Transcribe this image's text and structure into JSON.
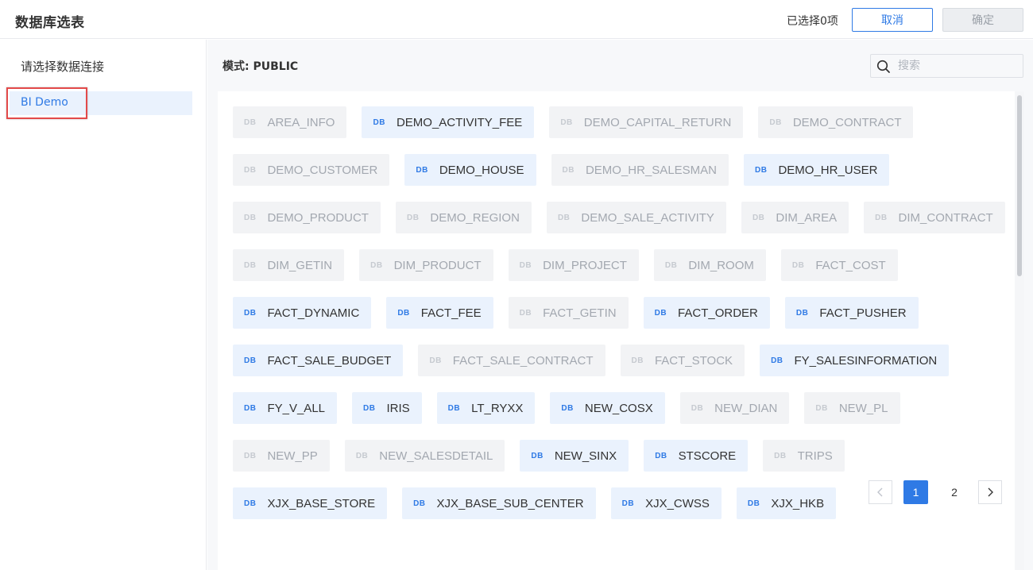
{
  "header": {
    "title": "数据库选表",
    "selected_count": "已选择0项",
    "cancel_label": "取消",
    "confirm_label": "确定"
  },
  "sidebar": {
    "section_label": "请选择数据连接",
    "connections": [
      {
        "label": "BI Demo",
        "selected": true
      }
    ]
  },
  "main": {
    "schema_label": "模式: PUBLIC",
    "search": {
      "placeholder": "搜索",
      "value": ""
    },
    "db_badge": "DB",
    "tables": [
      {
        "name": "AREA_INFO",
        "enabled": false
      },
      {
        "name": "DEMO_ACTIVITY_FEE",
        "enabled": true
      },
      {
        "name": "DEMO_CAPITAL_RETURN",
        "enabled": false
      },
      {
        "name": "DEMO_CONTRACT",
        "enabled": false
      },
      {
        "name": "DEMO_CUSTOMER",
        "enabled": false
      },
      {
        "name": "DEMO_HOUSE",
        "enabled": true
      },
      {
        "name": "DEMO_HR_SALESMAN",
        "enabled": false
      },
      {
        "name": "DEMO_HR_USER",
        "enabled": true
      },
      {
        "name": "DEMO_PRODUCT",
        "enabled": false
      },
      {
        "name": "DEMO_REGION",
        "enabled": false
      },
      {
        "name": "DEMO_SALE_ACTIVITY",
        "enabled": false
      },
      {
        "name": "DIM_AREA",
        "enabled": false
      },
      {
        "name": "DIM_CONTRACT",
        "enabled": false
      },
      {
        "name": "DIM_GETIN",
        "enabled": false
      },
      {
        "name": "DIM_PRODUCT",
        "enabled": false
      },
      {
        "name": "DIM_PROJECT",
        "enabled": false
      },
      {
        "name": "DIM_ROOM",
        "enabled": false
      },
      {
        "name": "FACT_COST",
        "enabled": false
      },
      {
        "name": "FACT_DYNAMIC",
        "enabled": true
      },
      {
        "name": "FACT_FEE",
        "enabled": true
      },
      {
        "name": "FACT_GETIN",
        "enabled": false
      },
      {
        "name": "FACT_ORDER",
        "enabled": true
      },
      {
        "name": "FACT_PUSHER",
        "enabled": true
      },
      {
        "name": "FACT_SALE_BUDGET",
        "enabled": true
      },
      {
        "name": "FACT_SALE_CONTRACT",
        "enabled": false
      },
      {
        "name": "FACT_STOCK",
        "enabled": false
      },
      {
        "name": "FY_SALESINFORMATION",
        "enabled": true
      },
      {
        "name": "FY_V_ALL",
        "enabled": true
      },
      {
        "name": "IRIS",
        "enabled": true
      },
      {
        "name": "LT_RYXX",
        "enabled": true
      },
      {
        "name": "NEW_COSX",
        "enabled": true
      },
      {
        "name": "NEW_DIAN",
        "enabled": false
      },
      {
        "name": "NEW_PL",
        "enabled": false
      },
      {
        "name": "NEW_PP",
        "enabled": false
      },
      {
        "name": "NEW_SALESDETAIL",
        "enabled": false
      },
      {
        "name": "NEW_SINX",
        "enabled": true
      },
      {
        "name": "STSCORE",
        "enabled": true
      },
      {
        "name": "TRIPS",
        "enabled": false
      },
      {
        "name": "XJX_BASE_STORE",
        "enabled": true
      },
      {
        "name": "XJX_BASE_SUB_CENTER",
        "enabled": true
      },
      {
        "name": "XJX_CWSS",
        "enabled": true
      },
      {
        "name": "XJX_HKB",
        "enabled": true
      }
    ],
    "pagination": {
      "current_page": "1",
      "pages": [
        "1",
        "2"
      ],
      "prev_icon": "chevron-left-icon",
      "next_icon": "chevron-right-icon"
    }
  },
  "colors": {
    "accent": "#2f7ae5",
    "highlight_border": "#e34a4a",
    "enabled_tag_bg": "#eaf2fd",
    "disabled_tag_bg": "#f2f3f5"
  }
}
